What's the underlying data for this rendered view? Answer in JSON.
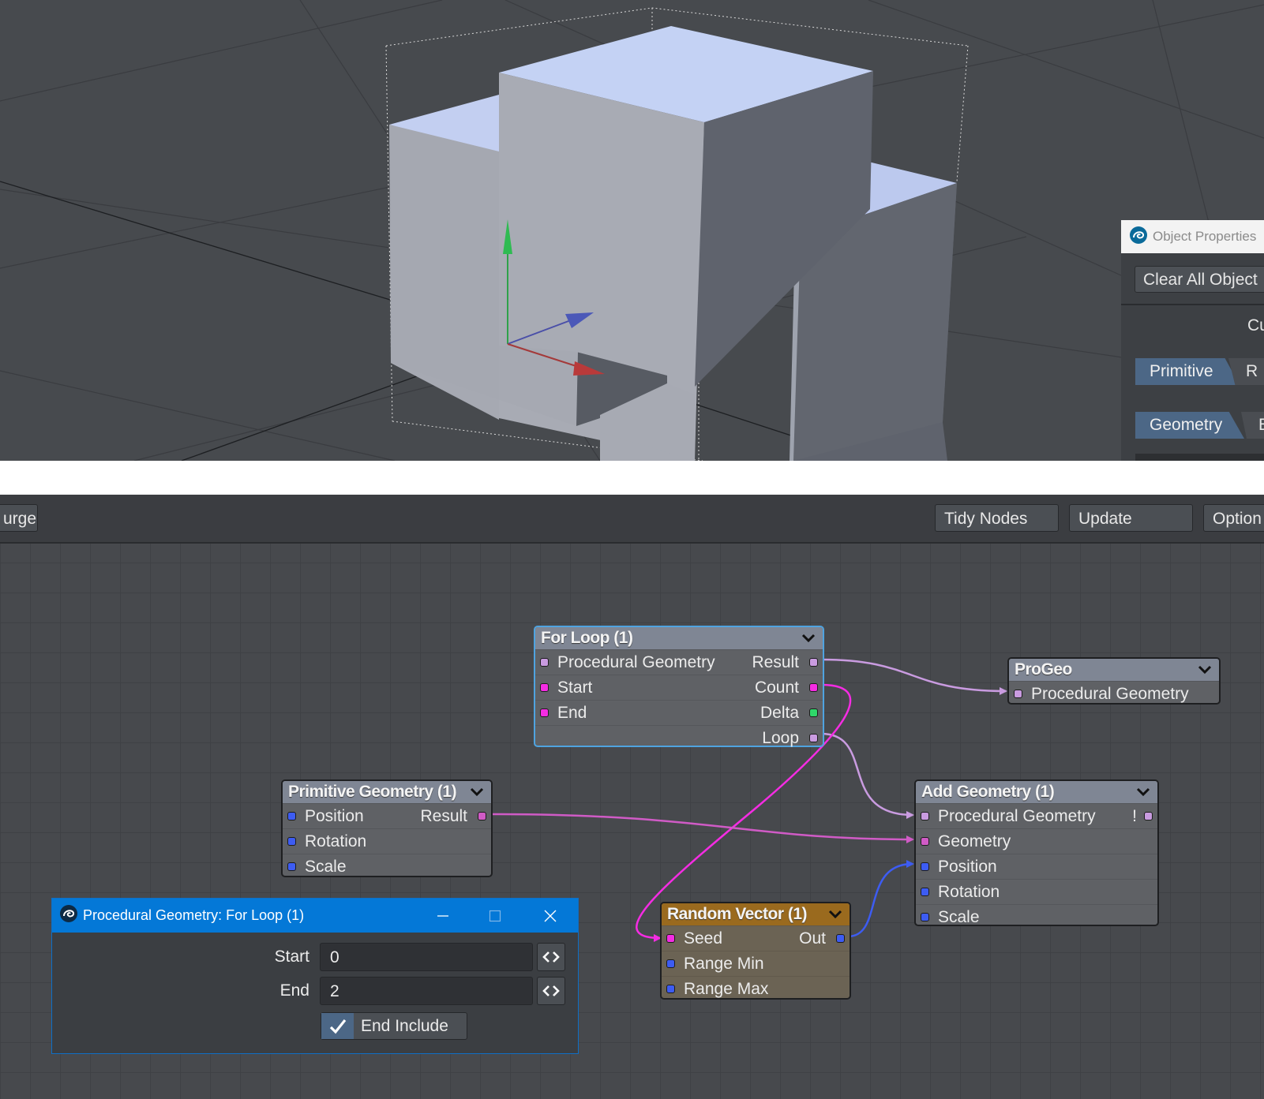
{
  "object_properties": {
    "title": "Object Properties",
    "clear_button": "Clear All Object",
    "partial_label": "Cu",
    "tab_primitive": "Primitive",
    "tab_partial_r": "R",
    "tab_geometry": "Geometry",
    "tab_partial_e": "E"
  },
  "toolbar": {
    "purge_partial": "urge",
    "tidy_nodes": "Tidy Nodes",
    "update": "Update",
    "options": "Option"
  },
  "nodes": {
    "for_loop": {
      "title": "For Loop (1)",
      "inputs": [
        "Procedural Geometry",
        "Start",
        "End"
      ],
      "outputs": [
        "Result",
        "Count",
        "Delta",
        "Loop"
      ]
    },
    "progeo": {
      "title": "ProGeo",
      "inputs": [
        "Procedural Geometry"
      ]
    },
    "primitive_geometry": {
      "title": "Primitive Geometry (1)",
      "inputs": [
        "Position",
        "Rotation",
        "Scale"
      ],
      "outputs": [
        "Result"
      ]
    },
    "add_geometry": {
      "title": "Add Geometry (1)",
      "inputs": [
        "Procedural Geometry",
        "Geometry",
        "Position",
        "Rotation",
        "Scale"
      ],
      "warning": "!"
    },
    "random_vector": {
      "title": "Random Vector (1)",
      "inputs": [
        "Seed",
        "Range Min",
        "Range Max"
      ],
      "outputs": [
        "Out"
      ]
    }
  },
  "dialog": {
    "title": "Procedural Geometry: For Loop (1)",
    "start_label": "Start",
    "start_value": "0",
    "end_label": "End",
    "end_value": "2",
    "end_include_label": "End Include",
    "end_include_checked": true
  },
  "colors": {
    "port_procedural": "#c99be0",
    "port_integer": "#f52ce3",
    "port_vector": "#3d5cf2",
    "port_scalar": "#2fd86a",
    "node_header": "#7f8694",
    "random_vector_header": "#9a6a1e",
    "selected_border": "#4fa3e0",
    "dialog_titlebar": "#0478d7"
  },
  "icons": {
    "app_logo": "lightwave-logo-icon",
    "node_collapse": "chevron-down-icon"
  }
}
